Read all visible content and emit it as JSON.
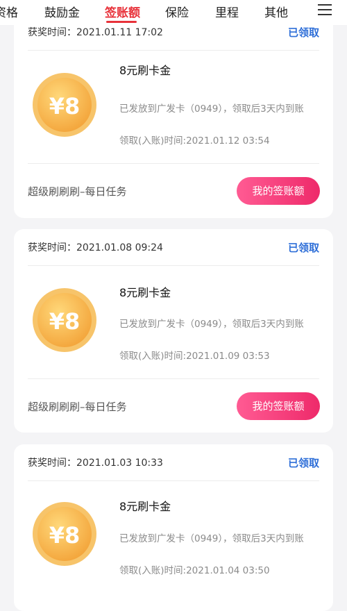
{
  "tabs": [
    {
      "label": "资格",
      "active": false
    },
    {
      "label": "鼓励金",
      "active": false
    },
    {
      "label": "签账额",
      "active": true
    },
    {
      "label": "保险",
      "active": false
    },
    {
      "label": "里程",
      "active": false
    },
    {
      "label": "其他",
      "active": false
    }
  ],
  "colors": {
    "accent": "#e8323a",
    "status_blue": "#2f6fd8",
    "button_pink": "#ee2a6a"
  },
  "coin_label": "¥8",
  "cards": [
    {
      "award_time": "获奖时间：2021.01.11 17:02",
      "status": "已领取",
      "title": "8元刷卡金",
      "desc": "已发放到广发卡（0949），领取后3天内到账",
      "received": "领取(入账)时间:2021.01.12 03:54",
      "task": "超级刷刷刷–每日任务",
      "button": "我的签账额"
    },
    {
      "award_time": "获奖时间：2021.01.08 09:24",
      "status": "已领取",
      "title": "8元刷卡金",
      "desc": "已发放到广发卡（0949），领取后3天内到账",
      "received": "领取(入账)时间:2021.01.09 03:53",
      "task": "超级刷刷刷–每日任务",
      "button": "我的签账额"
    },
    {
      "award_time": "获奖时间：2021.01.03 10:33",
      "status": "已领取",
      "title": "8元刷卡金",
      "desc": "已发放到广发卡（0949），领取后3天内到账",
      "received": "领取(入账)时间:2021.01.04 03:50"
    }
  ]
}
